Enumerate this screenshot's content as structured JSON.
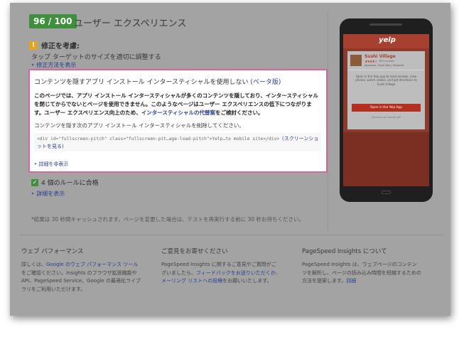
{
  "header": {
    "score": "96 / 100",
    "title": "ユーザー エクスペリエンス"
  },
  "warning": {
    "icon": "!",
    "title": "修正を考慮:",
    "rule": "タップ ターゲットのサイズを適切に調整する",
    "fix_link": "‣ 修正方法を表示"
  },
  "panel": {
    "title": "コンテンツを隠すアプリ インストール インタースティシャルを使用しない ",
    "title_beta": "(ベータ版)",
    "desc_part1": "このページでは、アプリ インストール インタースティシャルが多くのコンテンツを隠しており、インタースティシャルを閉じてからでないとページを使用できません。このようなページはユーザー エクスペリエンスの低下につながります。ユーザー エクスペリエンス向上のため、",
    "desc_link": "インタースティシャルの代替案",
    "desc_part2": "をご検討ください。",
    "hint": "コンテンツを隠す次のアプリ インストール インタースティシャルを削除してください。",
    "code": "<div id=\"fullscreen-pitch\" class=\"fullscreen-pit…age-load-pitch\">Yelp…to mobile site</div> ",
    "code_link": "(スクリーンショットを見る)",
    "hide_link": "‣ 詳細を非表示"
  },
  "passed": {
    "icon": "✓",
    "title": "4 個のルールに合格",
    "details_link": "‣ 詳細を表示"
  },
  "cache_note": "*結果は 30 秒間キャッシュされます。ページを変更した場合は、テストを再実行する前に 30 秒お待ちください。",
  "phone": {
    "logo": "yelp",
    "biz_name": "Sushi Village",
    "stars": "★★★★☆",
    "reviews": "364 reviews",
    "biz_meta": "Japanese, Sushi Bars, Desserts",
    "promo": "Open in the Yelp app to read reviews, view photos, watch videos, and get directions to Sushi Village",
    "open_button": "Open in the Yelp App",
    "mobile_link": "Continue to mobile site"
  },
  "footer": {
    "col1": {
      "title": "ウェブ パフォーマンス",
      "t1": "詳しくは、",
      "link1": "Google のウェブ パフォーマンス ツール",
      "t2": "をご確認ください。Insights のブラウザ拡張機能や API、PageSpeed Service、Google の最適化ライブラリをご利用いただけます。"
    },
    "col2": {
      "title": "ご意見をお寄せください",
      "t1": "PageSpeed Insights に関するご意見やご質問がございましたら、",
      "link1": "フィードバックをお送りいただくか",
      "t2": "、",
      "link2": "メーリング リストへの投稿",
      "t3": "をお願いいたします。"
    },
    "col3": {
      "title": "PageSpeed Insights について",
      "t1": "PageSpeed Insights は、ウェブページのコンテンツを解析し、ページの読み込み時間を短縮するための方法を提案します。",
      "link1": "詳細"
    }
  }
}
